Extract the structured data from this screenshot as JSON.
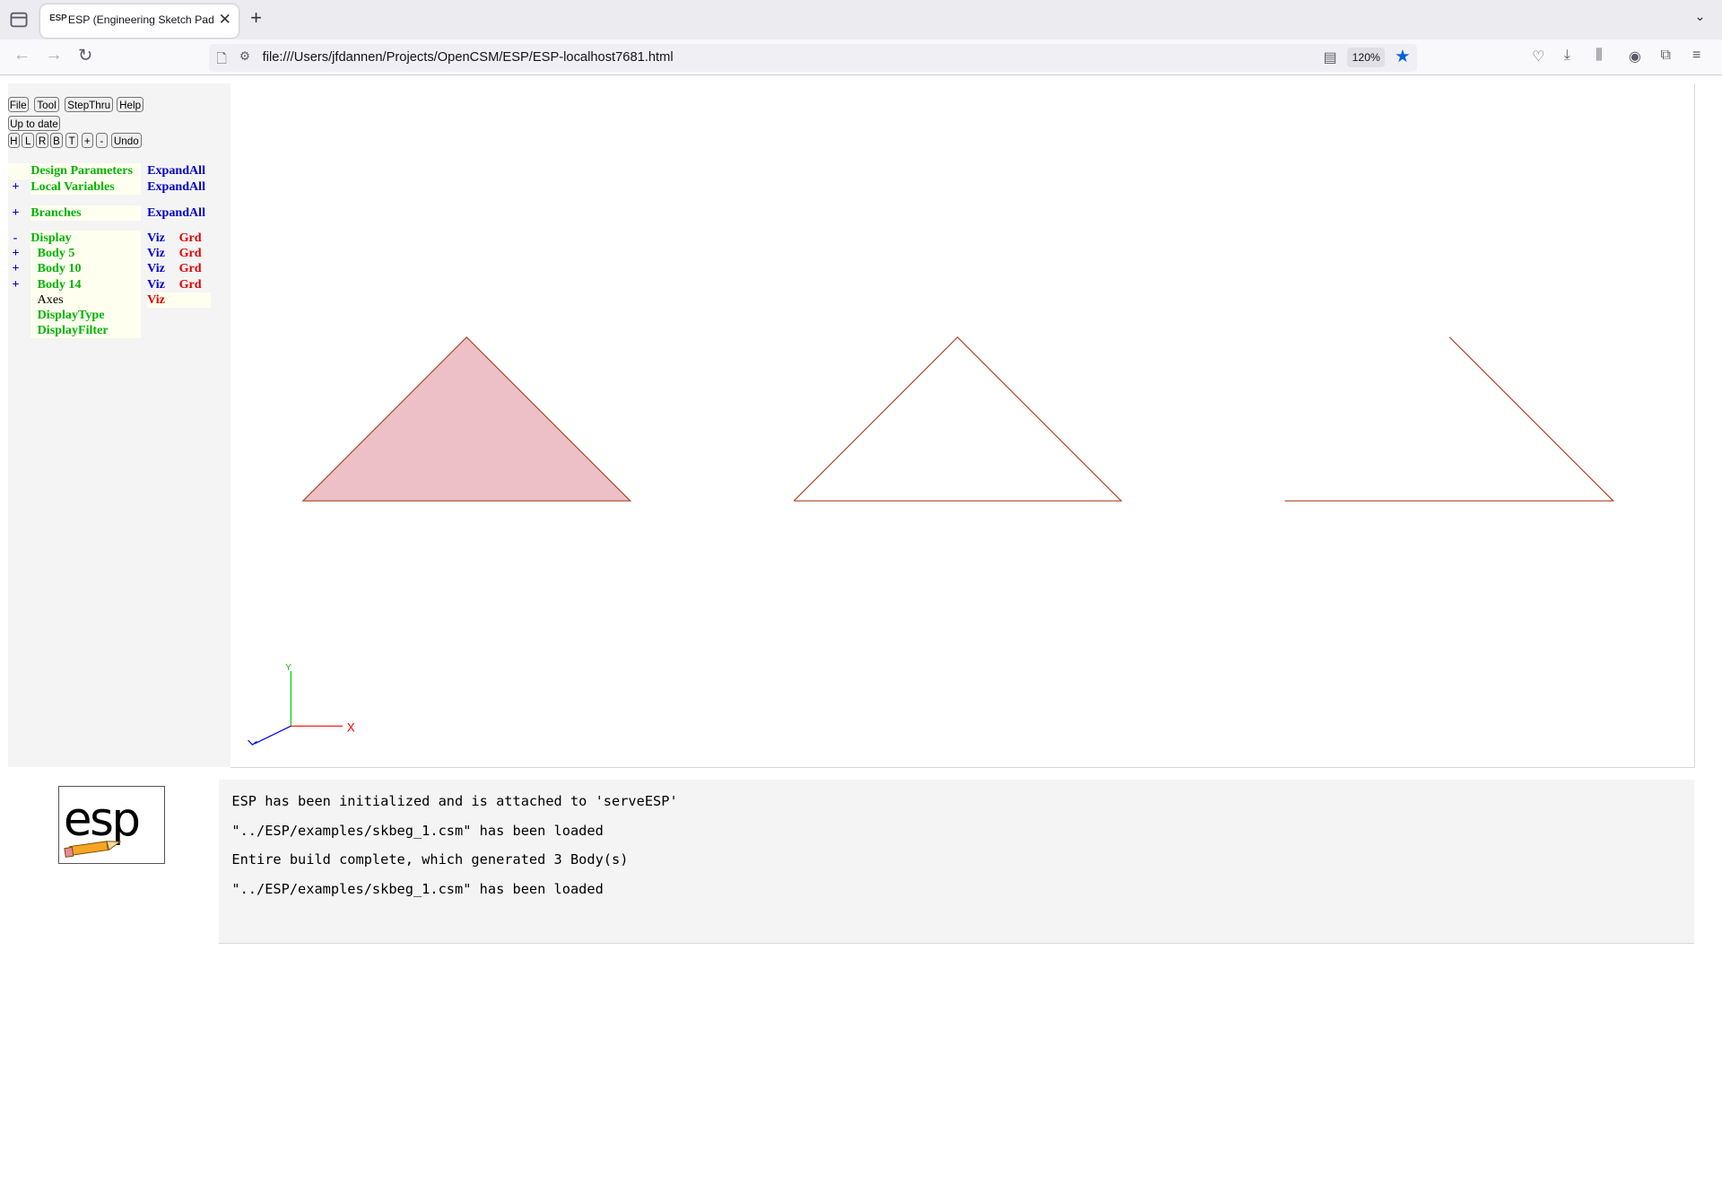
{
  "browser": {
    "tab_title": "ESP (Engineering Sketch Pad, V",
    "tab_favicon": "ESP",
    "url": "file:///Users/jfdannen/Projects/OpenCSM/ESP/ESP-localhost7681.html",
    "zoom": "120%",
    "icons": {
      "tab_list": "tab-list-icon",
      "new_tab": "plus-icon",
      "tabs_overflow": "chevron-down-icon",
      "back": "arrow-left-icon",
      "forward": "arrow-right-icon",
      "reload": "reload-icon",
      "page": "page-icon",
      "permissions": "permissions-icon",
      "reader": "reader-view-icon",
      "bookmark": "star-icon",
      "pocket": "pocket-icon",
      "downloads": "download-icon",
      "library": "library-icon",
      "account": "account-icon",
      "extensions": "extensions-icon",
      "menu": "hamburger-menu-icon"
    },
    "accent": "#0061e0"
  },
  "toolbar": {
    "file": "File",
    "tool": "Tool",
    "stepthru": "StepThru",
    "help": "Help",
    "status": "Up to date",
    "view_h": "H",
    "view_l": "L",
    "view_r": "R",
    "view_b": "B",
    "view_t": "T",
    "zoom_in": "+",
    "zoom_out": "-",
    "undo": "Undo"
  },
  "tree": {
    "design_parameters": {
      "label": "Design Parameters",
      "action": "ExpandAll"
    },
    "local_variables": {
      "toggle": "+",
      "label": "Local Variables",
      "action": "ExpandAll"
    },
    "branches": {
      "toggle": "+",
      "label": "Branches",
      "action": "ExpandAll"
    },
    "display": {
      "toggle": "-",
      "label": "Display",
      "viz": "Viz",
      "grd": "Grd"
    },
    "bodies": [
      {
        "toggle": "+",
        "label": "Body 5",
        "viz": "Viz",
        "grd": "Grd"
      },
      {
        "toggle": "+",
        "label": "Body 10",
        "viz": "Viz",
        "grd": "Grd"
      },
      {
        "toggle": "+",
        "label": "Body 14",
        "viz": "Viz",
        "grd": "Grd"
      }
    ],
    "axes": {
      "label": "Axes",
      "viz": "Viz"
    },
    "display_type": "DisplayType",
    "display_filter": "DisplayFilter"
  },
  "graphics": {
    "axis_labels": {
      "x": "X",
      "y": "Y"
    },
    "colors": {
      "edge": "#b04a2a",
      "face": "#ecc0c6",
      "x_axis": "#ff0000",
      "y_axis": "#00cc00",
      "z_axis": "#0000ff"
    }
  },
  "messages": [
    "ESP has been initialized and is attached to 'serveESP'",
    "\"../ESP/examples/skbeg_1.csm\" has been loaded",
    "Entire build complete, which generated 3 Body(s)",
    "\"../ESP/examples/skbeg_1.csm\" has been loaded"
  ],
  "logo": {
    "text": "esp"
  }
}
